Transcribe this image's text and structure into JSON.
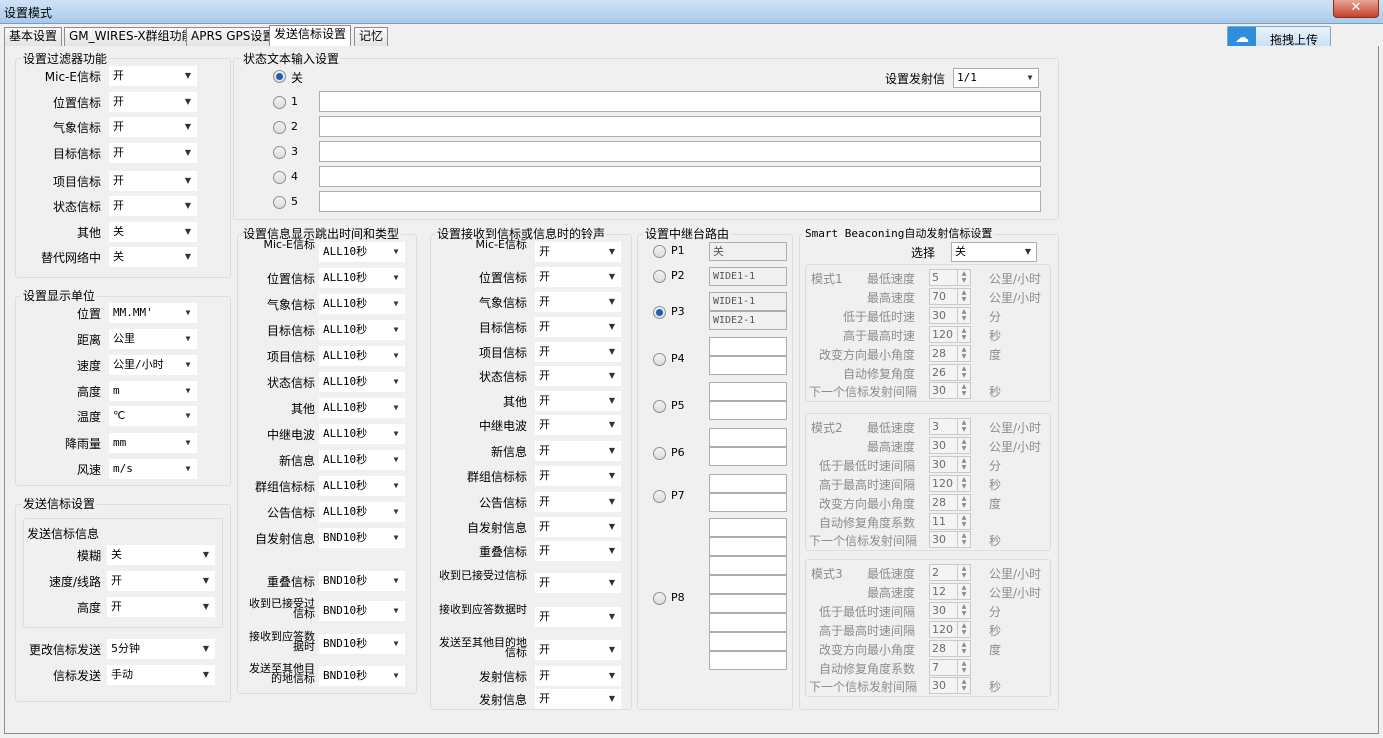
{
  "window": {
    "title": "设置模式",
    "close": "✕"
  },
  "tabs": [
    "基本设置",
    "GM_WIRES-X群组功能",
    "APRS GPS设置",
    "发送信标设置",
    "记忆"
  ],
  "upload_label": "拖拽上传",
  "filter": {
    "title": "设置过滤器功能",
    "rows": [
      {
        "label": "Mic-E信标",
        "value": "开"
      },
      {
        "label": "位置信标",
        "value": "开"
      },
      {
        "label": "气象信标",
        "value": "开"
      },
      {
        "label": "目标信标",
        "value": "开"
      },
      {
        "label": "项目信标",
        "value": "开"
      },
      {
        "label": "状态信标",
        "value": "开"
      },
      {
        "label": "其他",
        "value": "关"
      },
      {
        "label": "替代网络中",
        "value": "关"
      }
    ]
  },
  "units": {
    "title": "设置显示单位",
    "rows": [
      {
        "label": "位置",
        "value": "MM.MM'"
      },
      {
        "label": "距离",
        "value": "公里"
      },
      {
        "label": "速度",
        "value": "公里/小时"
      },
      {
        "label": "高度",
        "value": "m"
      },
      {
        "label": "温度",
        "value": "℃"
      },
      {
        "label": "降雨量",
        "value": "mm"
      },
      {
        "label": "风速",
        "value": "m/s"
      }
    ]
  },
  "send": {
    "title": "发送信标设置",
    "info_title": "发送信标信息",
    "info_rows": [
      {
        "label": "模糊",
        "value": "关"
      },
      {
        "label": "速度/线路",
        "value": "开"
      },
      {
        "label": "高度",
        "value": "开"
      }
    ],
    "rows": [
      {
        "label": "更改信标发送",
        "value": "5分钟"
      },
      {
        "label": "信标发送",
        "value": "手动"
      }
    ]
  },
  "status_text": {
    "title": "状态文本输入设置",
    "options": [
      "关",
      "1",
      "2",
      "3",
      "4",
      "5"
    ],
    "selected": 0,
    "beacon_label": "设置发射信",
    "beacon_value": "1/1"
  },
  "popup": {
    "title": "设置信息显示跳出时间和类型",
    "rows": [
      {
        "label": "Mic-E信标",
        "value": "ALL10秒"
      },
      {
        "label": "位置信标",
        "value": "ALL10秒"
      },
      {
        "label": "气象信标",
        "value": "ALL10秒"
      },
      {
        "label": "目标信标",
        "value": "ALL10秒"
      },
      {
        "label": "项目信标",
        "value": "ALL10秒"
      },
      {
        "label": "状态信标",
        "value": "ALL10秒"
      },
      {
        "label": "其他",
        "value": "ALL10秒"
      },
      {
        "label": "中继电波",
        "value": "ALL10秒"
      },
      {
        "label": "新信息",
        "value": "ALL10秒"
      },
      {
        "label": "群组信标标",
        "value": "ALL10秒"
      },
      {
        "label": "公告信标",
        "value": "ALL10秒"
      },
      {
        "label": "自发射信息",
        "value": "BND10秒"
      },
      {
        "label": "重叠信标",
        "value": "BND10秒"
      },
      {
        "label": "收到已接受过信标",
        "value": "BND10秒"
      },
      {
        "label": "接收到应答数据时",
        "value": "BND10秒"
      },
      {
        "label": "发送至其他目的地信标",
        "value": "BND10秒"
      }
    ]
  },
  "ringer": {
    "title": "设置接收到信标或信息时的铃声",
    "rows": [
      {
        "label": "Mic-E信标",
        "value": "开"
      },
      {
        "label": "位置信标",
        "value": "开"
      },
      {
        "label": "气象信标",
        "value": "开"
      },
      {
        "label": "目标信标",
        "value": "开"
      },
      {
        "label": "项目信标",
        "value": "开"
      },
      {
        "label": "状态信标",
        "value": "开"
      },
      {
        "label": "其他",
        "value": "开"
      },
      {
        "label": "中继电波",
        "value": "开"
      },
      {
        "label": "新信息",
        "value": "开"
      },
      {
        "label": "群组信标标",
        "value": "开"
      },
      {
        "label": "公告信标",
        "value": "开"
      },
      {
        "label": "自发射信息",
        "value": "开"
      },
      {
        "label": "重叠信标",
        "value": "开"
      },
      {
        "label": "收到已接受过信标",
        "value": "开"
      },
      {
        "label": "接收到应答数据时",
        "value": "开"
      },
      {
        "label": "发送至其他目的地信标",
        "value": "开"
      },
      {
        "label": "发射信标",
        "value": "开"
      },
      {
        "label": "发射信息",
        "value": "开"
      }
    ]
  },
  "digipath": {
    "title": "设置中继台路由",
    "options": [
      {
        "label": "P1",
        "values": [
          "关"
        ]
      },
      {
        "label": "P2",
        "values": [
          "WIDE1-1"
        ]
      },
      {
        "label": "P3",
        "values": [
          "WIDE1-1",
          "WIDE2-1"
        ]
      },
      {
        "label": "P4",
        "values": [
          "",
          ""
        ]
      },
      {
        "label": "P5",
        "values": [
          "",
          ""
        ]
      },
      {
        "label": "P6",
        "values": [
          "",
          ""
        ]
      },
      {
        "label": "P7",
        "values": [
          "",
          ""
        ]
      },
      {
        "label": "P8",
        "values": [
          "",
          "",
          "",
          "",
          "",
          "",
          "",
          ""
        ]
      }
    ],
    "selected": 2
  },
  "smart": {
    "title": "Smart Beaconing自动发射信标设置",
    "select_label": "选择",
    "select_value": "关",
    "modes": [
      {
        "name": "模式1",
        "rows": [
          {
            "label": "最低速度",
            "value": "5",
            "unit": "公里/小时"
          },
          {
            "label": "最高速度",
            "value": "70",
            "unit": "公里/小时"
          },
          {
            "label": "低于最低时速",
            "value": "30",
            "unit": "分"
          },
          {
            "label": "高于最高时速",
            "value": "120",
            "unit": "秒"
          },
          {
            "label": "改变方向最小角度",
            "value": "28",
            "unit": "度"
          },
          {
            "label": "自动修复角度",
            "value": "26",
            "unit": ""
          },
          {
            "label": "下一个信标发射间隔",
            "value": "30",
            "unit": "秒"
          }
        ]
      },
      {
        "name": "模式2",
        "rows": [
          {
            "label": "最低速度",
            "value": "3",
            "unit": "公里/小时"
          },
          {
            "label": "最高速度",
            "value": "30",
            "unit": "公里/小时"
          },
          {
            "label": "低于最低时速间隔",
            "value": "30",
            "unit": "分"
          },
          {
            "label": "高于最高时速间隔",
            "value": "120",
            "unit": "秒"
          },
          {
            "label": "改变方向最小角度",
            "value": "28",
            "unit": "度"
          },
          {
            "label": "自动修复角度系数",
            "value": "11",
            "unit": ""
          },
          {
            "label": "下一个信标发射间隔",
            "value": "30",
            "unit": "秒"
          }
        ]
      },
      {
        "name": "模式3",
        "rows": [
          {
            "label": "最低速度",
            "value": "2",
            "unit": "公里/小时"
          },
          {
            "label": "最高速度",
            "value": "12",
            "unit": "公里/小时"
          },
          {
            "label": "低于最低时速间隔",
            "value": "30",
            "unit": "分"
          },
          {
            "label": "高于最高时速间隔",
            "value": "120",
            "unit": "秒"
          },
          {
            "label": "改变方向最小角度",
            "value": "28",
            "unit": "度"
          },
          {
            "label": "自动修复角度系数",
            "value": "7",
            "unit": ""
          },
          {
            "label": "下一个信标发射间隔",
            "value": "30",
            "unit": "秒"
          }
        ]
      }
    ]
  }
}
